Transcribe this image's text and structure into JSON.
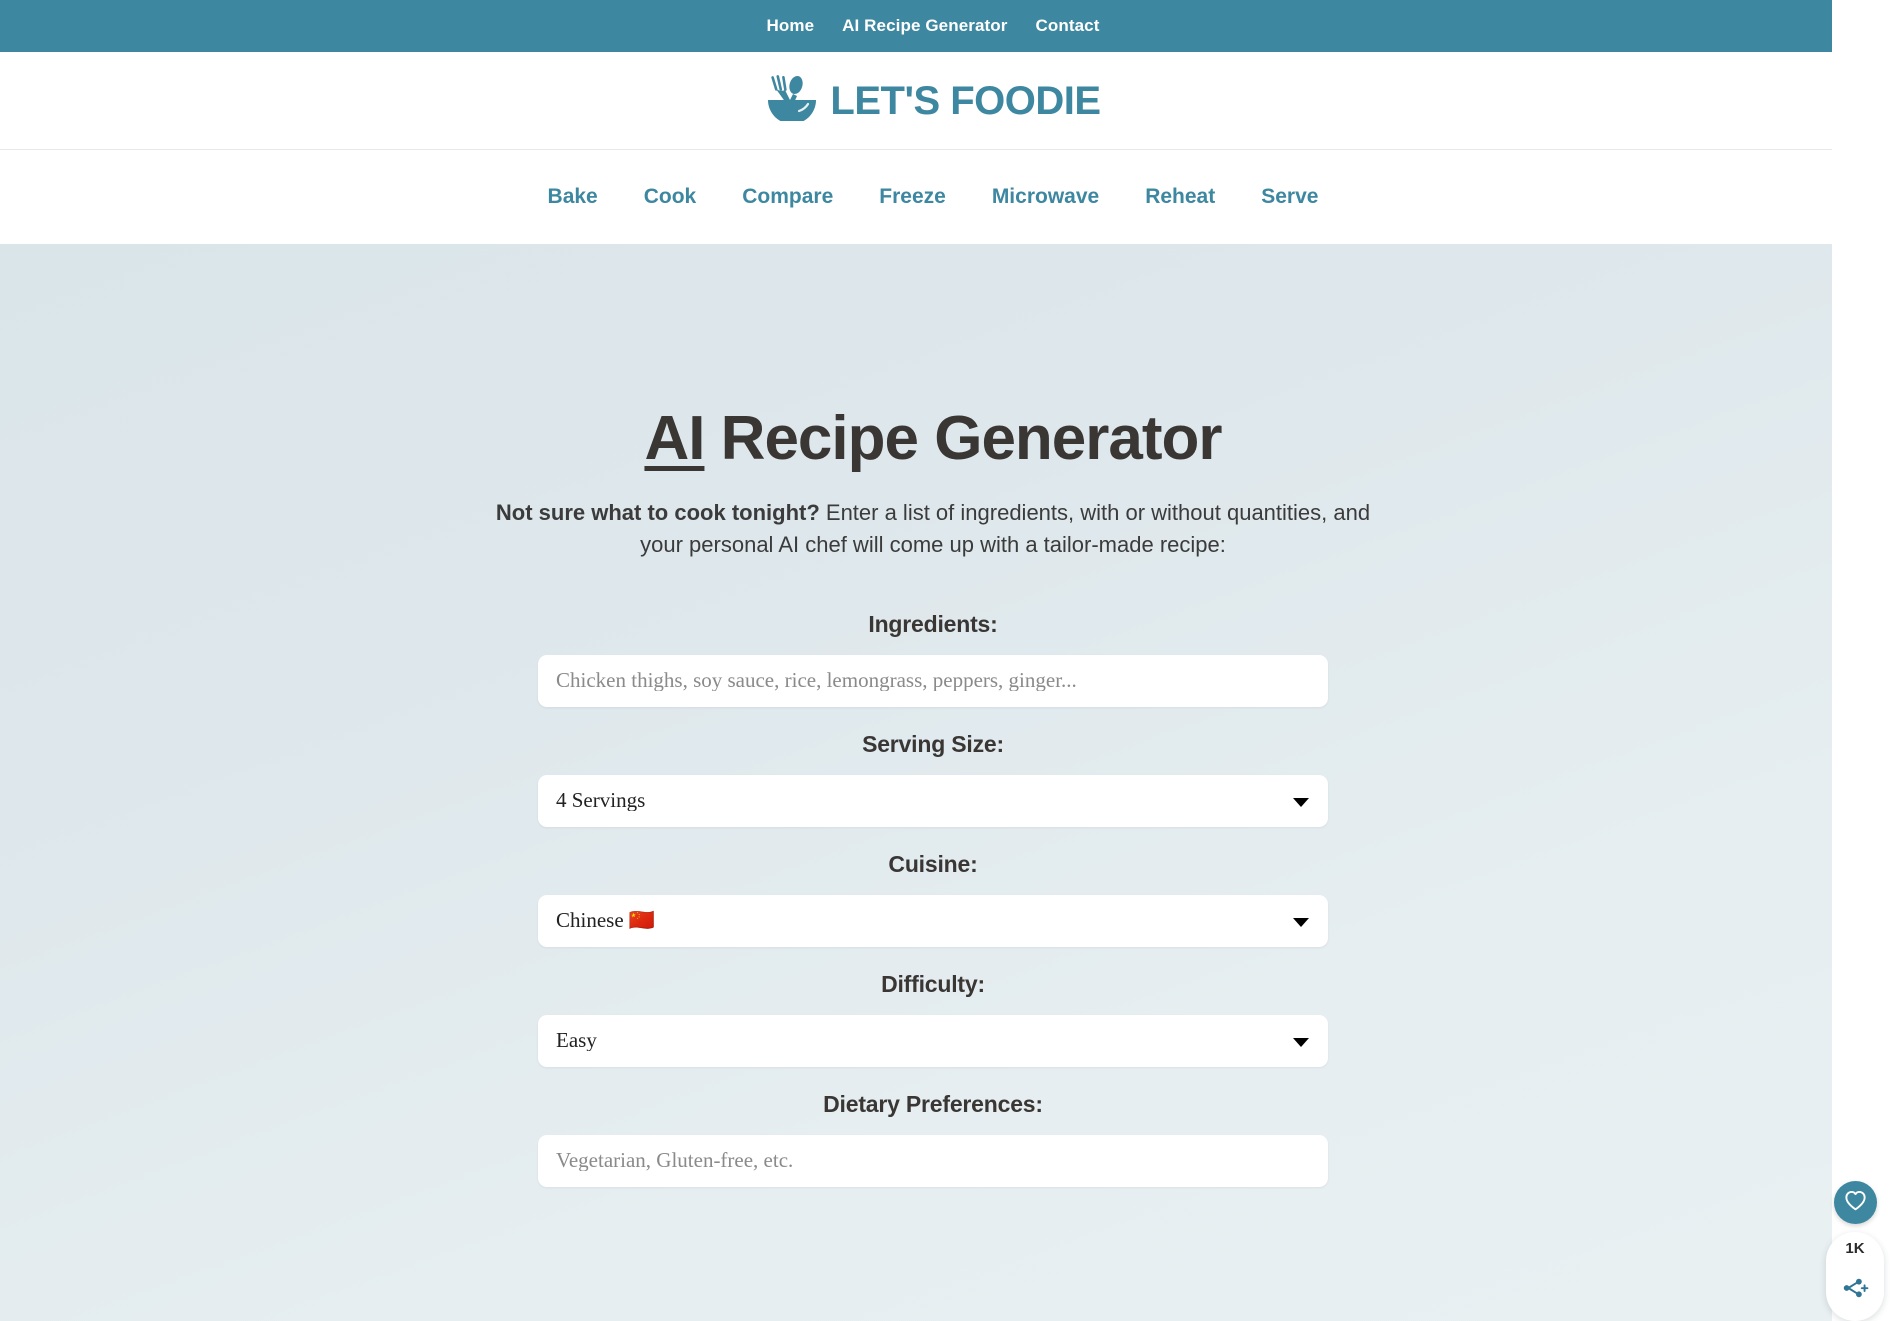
{
  "colors": {
    "teal": "#3d87a0",
    "heading": "#393634",
    "hero_bg_start": "#dae5ea",
    "hero_bg_end": "#e9f0f2"
  },
  "topbar": {
    "links": [
      {
        "label": "Home"
      },
      {
        "label": "AI Recipe Generator"
      },
      {
        "label": "Contact"
      }
    ]
  },
  "logo": {
    "text": "LET'S FOODIE",
    "icon": "fork-spoon-bowl-icon"
  },
  "category_nav": {
    "links": [
      {
        "label": "Bake"
      },
      {
        "label": "Cook"
      },
      {
        "label": "Compare"
      },
      {
        "label": "Freeze"
      },
      {
        "label": "Microwave"
      },
      {
        "label": "Reheat"
      },
      {
        "label": "Serve"
      }
    ]
  },
  "hero": {
    "title_underlined": "AI",
    "title_rest": " Recipe Generator",
    "subtitle_bold": "Not sure what to cook tonight?",
    "subtitle_rest": " Enter a list of ingredients, with or without quantities, and your personal AI chef will come up with a tailor-made recipe:"
  },
  "form": {
    "ingredients": {
      "label": "Ingredients:",
      "placeholder": "Chicken thighs, soy sauce, rice, lemongrass, peppers, ginger...",
      "value": ""
    },
    "serving_size": {
      "label": "Serving Size:",
      "value": "4 Servings"
    },
    "cuisine": {
      "label": "Cuisine:",
      "value": "Chinese 🇨🇳"
    },
    "difficulty": {
      "label": "Difficulty:",
      "value": "Easy"
    },
    "dietary": {
      "label": "Dietary Preferences:",
      "placeholder": "Vegetarian, Gluten-free, etc.",
      "value": ""
    }
  },
  "floating_widget": {
    "favorite_icon": "heart-icon",
    "share_count": "1K",
    "share_icon": "share-plus-icon"
  }
}
